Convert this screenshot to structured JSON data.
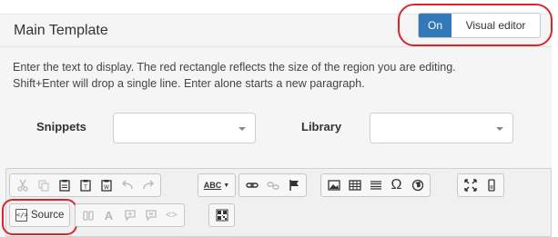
{
  "header": {
    "title": "Main Template",
    "toggle": {
      "on_label": "On",
      "off_label": "Visual editor"
    }
  },
  "help_text": {
    "line1": "Enter the text to display. The red rectangle reflects the size of the region you are editing.",
    "line2": "Shift+Enter will drop a single line. Enter alone starts a new paragraph."
  },
  "fields": {
    "snippets_label": "Snippets",
    "library_label": "Library",
    "snippets_value": "",
    "library_value": ""
  },
  "toolbar": {
    "source_label": "Source",
    "spell_check_label": "ABC",
    "special_char_glyph": "Ω",
    "show_blocks_glyph": "<>",
    "template_glyph": "A"
  },
  "colors": {
    "accent": "#3378b7",
    "annotation": "#d7262c",
    "panel": "#f5f5f5"
  }
}
